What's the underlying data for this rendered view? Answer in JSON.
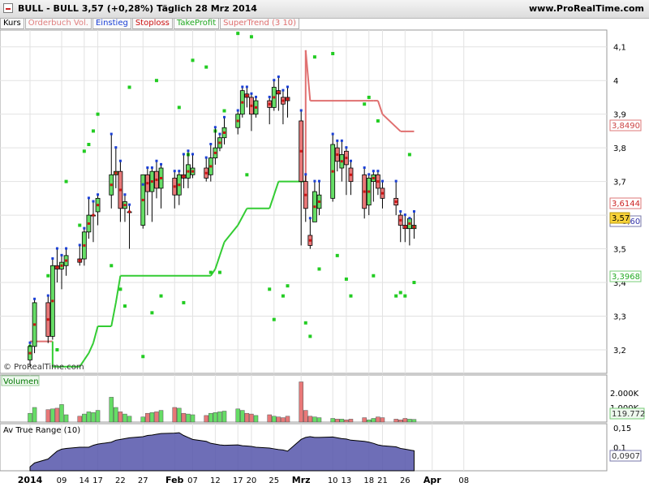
{
  "header": {
    "title": "BULL - BULL    3,57 (+0,28%)    Täglich  28 Mrz 2014",
    "site": "www.ProRealTime.com"
  },
  "tabs": [
    {
      "label": "Kurs",
      "color": "#000000"
    },
    {
      "label": "Orderbuch Vol.",
      "color": "#e08080"
    },
    {
      "label": "Einstieg",
      "color": "#1a3fd6"
    },
    {
      "label": "Stoploss",
      "color": "#cc1111"
    },
    {
      "label": "TakeProfit",
      "color": "#22aa22"
    },
    {
      "label": "SuperTrend (3 10)",
      "color": "#e07070"
    }
  ],
  "watermark": "© ProRealTime.com",
  "panels": {
    "volume_label": "Volumen",
    "atr_label": "Av True Range (10)"
  },
  "badges": {
    "supertrend": "3,8490",
    "stoploss": "3,6144",
    "price": "3,57",
    "price_hidden": "3,60",
    "takeprofit": "3,3968",
    "volume": "119.772",
    "atr": "0,0907"
  },
  "chart_data": {
    "type": "candlestick",
    "title": "BULL - BULL",
    "price_axis": {
      "ylim": [
        3.13,
        4.15
      ],
      "ticks": [
        "4,1",
        "4",
        "3,9",
        "3,8",
        "3,7",
        "3,6",
        "3,5",
        "3,4",
        "3,3",
        "3,2"
      ]
    },
    "volume_axis": {
      "ticks": [
        "2.000K",
        "1.000K"
      ]
    },
    "atr_axis": {
      "ticks": [
        "0,15",
        "0,1"
      ]
    },
    "date_ticks": [
      {
        "label": "2014",
        "date": "2014-01-02"
      },
      {
        "label": "09",
        "date": "2014-01-09"
      },
      {
        "label": "14",
        "date": "2014-01-14"
      },
      {
        "label": "17",
        "date": "2014-01-17"
      },
      {
        "label": "22",
        "date": "2014-01-22"
      },
      {
        "label": "27",
        "date": "2014-01-27"
      },
      {
        "label": "Feb",
        "date": "2014-02-03"
      },
      {
        "label": "07",
        "date": "2014-02-07"
      },
      {
        "label": "12",
        "date": "2014-02-12"
      },
      {
        "label": "17",
        "date": "2014-02-17"
      },
      {
        "label": "20",
        "date": "2014-02-20"
      },
      {
        "label": "25",
        "date": "2014-02-25"
      },
      {
        "label": "Mrz",
        "date": "2014-03-03"
      },
      {
        "label": "10",
        "date": "2014-03-10"
      },
      {
        "label": "13",
        "date": "2014-03-13"
      },
      {
        "label": "18",
        "date": "2014-03-18"
      },
      {
        "label": "21",
        "date": "2014-03-21"
      },
      {
        "label": "26",
        "date": "2014-03-26"
      },
      {
        "label": "Apr",
        "date": "2014-04-01"
      },
      {
        "label": "08",
        "date": "2014-04-08"
      }
    ],
    "candles": [
      {
        "date": "2014-01-02",
        "o": 3.17,
        "h": 3.22,
        "l": 3.15,
        "c": 3.21
      },
      {
        "date": "2014-01-03",
        "o": 3.21,
        "h": 3.35,
        "l": 3.19,
        "c": 3.34
      },
      {
        "date": "2014-01-06",
        "o": 3.34,
        "h": 3.36,
        "l": 3.22,
        "c": 3.24
      },
      {
        "date": "2014-01-07",
        "o": 3.24,
        "h": 3.47,
        "l": 3.23,
        "c": 3.45
      },
      {
        "date": "2014-01-08",
        "o": 3.45,
        "h": 3.5,
        "l": 3.4,
        "c": 3.44
      },
      {
        "date": "2014-01-09",
        "o": 3.44,
        "h": 3.48,
        "l": 3.38,
        "c": 3.46
      },
      {
        "date": "2014-01-10",
        "o": 3.45,
        "h": 3.5,
        "l": 3.42,
        "c": 3.48
      },
      {
        "date": "2014-01-13",
        "o": 3.47,
        "h": 3.51,
        "l": 3.45,
        "c": 3.46
      },
      {
        "date": "2014-01-14",
        "o": 3.47,
        "h": 3.56,
        "l": 3.45,
        "c": 3.55
      },
      {
        "date": "2014-01-15",
        "o": 3.55,
        "h": 3.65,
        "l": 3.53,
        "c": 3.6
      },
      {
        "date": "2014-01-16",
        "o": 3.6,
        "h": 3.64,
        "l": 3.52,
        "c": 3.6
      },
      {
        "date": "2014-01-17",
        "o": 3.61,
        "h": 3.66,
        "l": 3.57,
        "c": 3.65
      },
      {
        "date": "2014-01-20",
        "o": 3.66,
        "h": 3.84,
        "l": 3.62,
        "c": 3.72
      },
      {
        "date": "2014-01-21",
        "o": 3.72,
        "h": 3.8,
        "l": 3.68,
        "c": 3.73
      },
      {
        "date": "2014-01-22",
        "o": 3.73,
        "h": 3.76,
        "l": 3.58,
        "c": 3.62
      },
      {
        "date": "2014-01-23",
        "o": 3.62,
        "h": 3.66,
        "l": 3.58,
        "c": 3.64
      },
      {
        "date": "2014-01-24",
        "o": 3.61,
        "h": 3.63,
        "l": 3.5,
        "c": 3.61
      },
      {
        "date": "2014-01-27",
        "o": 3.57,
        "h": 3.69,
        "l": 3.56,
        "c": 3.72
      },
      {
        "date": "2014-01-28",
        "o": 3.72,
        "h": 3.74,
        "l": 3.6,
        "c": 3.67
      },
      {
        "date": "2014-01-29",
        "o": 3.67,
        "h": 3.74,
        "l": 3.58,
        "c": 3.73
      },
      {
        "date": "2014-01-30",
        "o": 3.73,
        "h": 3.76,
        "l": 3.65,
        "c": 3.68
      },
      {
        "date": "2014-01-31",
        "o": 3.68,
        "h": 3.75,
        "l": 3.62,
        "c": 3.74
      },
      {
        "date": "2014-02-03",
        "o": 3.71,
        "h": 3.73,
        "l": 3.62,
        "c": 3.66
      },
      {
        "date": "2014-02-04",
        "o": 3.66,
        "h": 3.73,
        "l": 3.63,
        "c": 3.72
      },
      {
        "date": "2014-02-05",
        "o": 3.72,
        "h": 3.78,
        "l": 3.68,
        "c": 3.71
      },
      {
        "date": "2014-02-06",
        "o": 3.71,
        "h": 3.79,
        "l": 3.68,
        "c": 3.75
      },
      {
        "date": "2014-02-07",
        "o": 3.72,
        "h": 3.78,
        "l": 3.71,
        "c": 3.74
      },
      {
        "date": "2014-02-10",
        "o": 3.74,
        "h": 3.77,
        "l": 3.7,
        "c": 3.71
      },
      {
        "date": "2014-02-11",
        "o": 3.72,
        "h": 3.81,
        "l": 3.7,
        "c": 3.77
      },
      {
        "date": "2014-02-12",
        "o": 3.77,
        "h": 3.86,
        "l": 3.75,
        "c": 3.8
      },
      {
        "date": "2014-02-13",
        "o": 3.8,
        "h": 3.84,
        "l": 3.79,
        "c": 3.83
      },
      {
        "date": "2014-02-14",
        "o": 3.83,
        "h": 3.89,
        "l": 3.81,
        "c": 3.86
      },
      {
        "date": "2014-02-17",
        "o": 3.86,
        "h": 3.91,
        "l": 3.84,
        "c": 3.9
      },
      {
        "date": "2014-02-18",
        "o": 3.9,
        "h": 3.98,
        "l": 3.89,
        "c": 3.97
      },
      {
        "date": "2014-02-19",
        "o": 3.96,
        "h": 3.98,
        "l": 3.92,
        "c": 3.95
      },
      {
        "date": "2014-02-20",
        "o": 3.95,
        "h": 3.96,
        "l": 3.85,
        "c": 3.9
      },
      {
        "date": "2014-02-21",
        "o": 3.9,
        "h": 3.95,
        "l": 3.89,
        "c": 3.94
      },
      {
        "date": "2014-02-24",
        "o": 3.94,
        "h": 3.95,
        "l": 3.87,
        "c": 3.92
      },
      {
        "date": "2014-02-25",
        "o": 3.92,
        "h": 4.0,
        "l": 3.91,
        "c": 3.98
      },
      {
        "date": "2014-02-26",
        "o": 3.97,
        "h": 4.01,
        "l": 3.91,
        "c": 3.96
      },
      {
        "date": "2014-02-27",
        "o": 3.95,
        "h": 3.97,
        "l": 3.87,
        "c": 3.93
      },
      {
        "date": "2014-02-28",
        "o": 3.95,
        "h": 3.98,
        "l": 3.89,
        "c": 3.94
      },
      {
        "date": "2014-03-03",
        "o": 3.88,
        "h": 3.91,
        "l": 3.51,
        "c": 3.7
      },
      {
        "date": "2014-03-04",
        "o": 3.7,
        "h": 3.72,
        "l": 3.58,
        "c": 3.62
      },
      {
        "date": "2014-03-05",
        "o": 3.54,
        "h": 3.59,
        "l": 3.5,
        "c": 3.51
      },
      {
        "date": "2014-03-06",
        "o": 3.58,
        "h": 3.7,
        "l": 3.58,
        "c": 3.67
      },
      {
        "date": "2014-03-07",
        "o": 3.62,
        "h": 3.7,
        "l": 3.6,
        "c": 3.66
      },
      {
        "date": "2014-03-10",
        "o": 3.65,
        "h": 3.84,
        "l": 3.64,
        "c": 3.81
      },
      {
        "date": "2014-03-11",
        "o": 3.8,
        "h": 3.82,
        "l": 3.73,
        "c": 3.76
      },
      {
        "date": "2014-03-12",
        "o": 3.74,
        "h": 3.82,
        "l": 3.7,
        "c": 3.78
      },
      {
        "date": "2014-03-13",
        "o": 3.79,
        "h": 3.8,
        "l": 3.66,
        "c": 3.75
      },
      {
        "date": "2014-03-14",
        "o": 3.74,
        "h": 3.76,
        "l": 3.66,
        "c": 3.7
      },
      {
        "date": "2014-03-17",
        "o": 3.72,
        "h": 3.74,
        "l": 3.59,
        "c": 3.62
      },
      {
        "date": "2014-03-18",
        "o": 3.63,
        "h": 3.72,
        "l": 3.6,
        "c": 3.71
      },
      {
        "date": "2014-03-19",
        "o": 3.7,
        "h": 3.73,
        "l": 3.64,
        "c": 3.72
      },
      {
        "date": "2014-03-20",
        "o": 3.72,
        "h": 3.73,
        "l": 3.66,
        "c": 3.68
      },
      {
        "date": "2014-03-21",
        "o": 3.68,
        "h": 3.7,
        "l": 3.62,
        "c": 3.65
      },
      {
        "date": "2014-03-24",
        "o": 3.65,
        "h": 3.7,
        "l": 3.6,
        "c": 3.63
      },
      {
        "date": "2014-03-25",
        "o": 3.6,
        "h": 3.61,
        "l": 3.52,
        "c": 3.57
      },
      {
        "date": "2014-03-26",
        "o": 3.57,
        "h": 3.6,
        "l": 3.52,
        "c": 3.56
      },
      {
        "date": "2014-03-27",
        "o": 3.56,
        "h": 3.59,
        "l": 3.51,
        "c": 3.59
      },
      {
        "date": "2014-03-28",
        "o": 3.56,
        "h": 3.61,
        "l": 3.53,
        "c": 3.57
      }
    ],
    "volume": [
      600,
      1000,
      850,
      900,
      950,
      1200,
      500,
      400,
      550,
      700,
      650,
      800,
      1700,
      1000,
      700,
      550,
      400,
      350,
      600,
      650,
      700,
      800,
      1000,
      950,
      600,
      550,
      500,
      450,
      600,
      650,
      700,
      750,
      900,
      800,
      600,
      550,
      450,
      500,
      400,
      350,
      300,
      400,
      2750,
      800,
      400,
      350,
      300,
      250,
      200,
      200,
      150,
      200,
      300,
      150,
      250,
      350,
      300,
      200,
      150,
      250,
      200,
      180
    ],
    "atr": [
      0.05,
      0.06,
      0.07,
      0.08,
      0.09,
      0.095,
      0.097,
      0.1,
      0.1,
      0.1,
      0.105,
      0.108,
      0.113,
      0.118,
      0.12,
      0.122,
      0.124,
      0.127,
      0.13,
      0.131,
      0.133,
      0.135,
      0.136,
      0.137,
      0.13,
      0.125,
      0.12,
      0.115,
      0.11,
      0.108,
      0.106,
      0.105,
      0.106,
      0.104,
      0.103,
      0.102,
      0.1,
      0.098,
      0.096,
      0.094,
      0.093,
      0.09,
      0.12,
      0.125,
      0.127,
      0.125,
      0.125,
      0.126,
      0.124,
      0.122,
      0.121,
      0.118,
      0.115,
      0.113,
      0.11,
      0.106,
      0.104,
      0.101,
      0.097,
      0.095,
      0.093,
      0.091
    ],
    "supertrend": [
      {
        "date": "2014-01-02",
        "v": 3.225,
        "side": "down"
      },
      {
        "date": "2014-01-06",
        "v": 3.225,
        "side": "down"
      },
      {
        "date": "2014-01-07",
        "v": 3.15,
        "side": "up"
      },
      {
        "date": "2014-01-13",
        "v": 3.15,
        "side": "up"
      },
      {
        "date": "2014-01-15",
        "v": 3.19,
        "side": "up"
      },
      {
        "date": "2014-01-16",
        "v": 3.22,
        "side": "up"
      },
      {
        "date": "2014-01-17",
        "v": 3.27,
        "side": "up"
      },
      {
        "date": "2014-01-20",
        "v": 3.27,
        "side": "up"
      },
      {
        "date": "2014-01-21",
        "v": 3.34,
        "side": "up"
      },
      {
        "date": "2014-01-22",
        "v": 3.42,
        "side": "up"
      },
      {
        "date": "2014-02-11",
        "v": 3.42,
        "side": "up"
      },
      {
        "date": "2014-02-12",
        "v": 3.44,
        "side": "up"
      },
      {
        "date": "2014-02-13",
        "v": 3.48,
        "side": "up"
      },
      {
        "date": "2014-02-14",
        "v": 3.52,
        "side": "up"
      },
      {
        "date": "2014-02-17",
        "v": 3.57,
        "side": "up"
      },
      {
        "date": "2014-02-19",
        "v": 3.62,
        "side": "up"
      },
      {
        "date": "2014-02-24",
        "v": 3.62,
        "side": "up"
      },
      {
        "date": "2014-02-26",
        "v": 3.7,
        "side": "up"
      },
      {
        "date": "2014-03-03",
        "v": 3.7,
        "side": "up"
      },
      {
        "date": "2014-03-04",
        "v": 4.09,
        "side": "down"
      },
      {
        "date": "2014-03-05",
        "v": 3.94,
        "side": "down"
      },
      {
        "date": "2014-03-19",
        "v": 3.94,
        "side": "down"
      },
      {
        "date": "2014-03-20",
        "v": 3.94,
        "side": "down"
      },
      {
        "date": "2014-03-21",
        "v": 3.9,
        "side": "down"
      },
      {
        "date": "2014-03-25",
        "v": 3.849,
        "side": "down"
      },
      {
        "date": "2014-03-28",
        "v": 3.849,
        "side": "down"
      }
    ],
    "takeprofit_dots": [
      {
        "date": "2014-01-02",
        "v": 3.21
      },
      {
        "date": "2014-01-06",
        "v": 3.42
      },
      {
        "date": "2014-01-08",
        "v": 3.2
      },
      {
        "date": "2014-01-10",
        "v": 3.7
      },
      {
        "date": "2014-01-13",
        "v": 3.57
      },
      {
        "date": "2014-01-14",
        "v": 3.79
      },
      {
        "date": "2014-01-15",
        "v": 3.81
      },
      {
        "date": "2014-01-16",
        "v": 3.85
      },
      {
        "date": "2014-01-17",
        "v": 3.9
      },
      {
        "date": "2014-01-20",
        "v": 3.45
      },
      {
        "date": "2014-01-22",
        "v": 3.38
      },
      {
        "date": "2014-01-23",
        "v": 3.33
      },
      {
        "date": "2014-01-24",
        "v": 3.98
      },
      {
        "date": "2014-01-27",
        "v": 3.18
      },
      {
        "date": "2014-01-28",
        "v": 3.68
      },
      {
        "date": "2014-01-29",
        "v": 3.31
      },
      {
        "date": "2014-01-30",
        "v": 4.0
      },
      {
        "date": "2014-01-31",
        "v": 3.36
      },
      {
        "date": "2014-02-04",
        "v": 3.92
      },
      {
        "date": "2014-02-05",
        "v": 3.34
      },
      {
        "date": "2014-02-06",
        "v": 3.78
      },
      {
        "date": "2014-02-07",
        "v": 4.06
      },
      {
        "date": "2014-02-10",
        "v": 4.04
      },
      {
        "date": "2014-02-11",
        "v": 3.43
      },
      {
        "date": "2014-02-12",
        "v": 3.85
      },
      {
        "date": "2014-02-13",
        "v": 3.43
      },
      {
        "date": "2014-02-14",
        "v": 3.91
      },
      {
        "date": "2014-02-17",
        "v": 4.14
      },
      {
        "date": "2014-02-18",
        "v": 3.92
      },
      {
        "date": "2014-02-19",
        "v": 3.72
      },
      {
        "date": "2014-02-20",
        "v": 4.13
      },
      {
        "date": "2014-02-24",
        "v": 3.38
      },
      {
        "date": "2014-02-25",
        "v": 3.29
      },
      {
        "date": "2014-02-27",
        "v": 3.36
      },
      {
        "date": "2014-02-28",
        "v": 3.39
      },
      {
        "date": "2014-03-04",
        "v": 3.28
      },
      {
        "date": "2014-03-05",
        "v": 3.24
      },
      {
        "date": "2014-03-06",
        "v": 4.07
      },
      {
        "date": "2014-03-07",
        "v": 3.44
      },
      {
        "date": "2014-03-10",
        "v": 4.08
      },
      {
        "date": "2014-03-11",
        "v": 3.48
      },
      {
        "date": "2014-03-13",
        "v": 3.41
      },
      {
        "date": "2014-03-14",
        "v": 3.36
      },
      {
        "date": "2014-03-17",
        "v": 3.93
      },
      {
        "date": "2014-03-18",
        "v": 3.95
      },
      {
        "date": "2014-03-19",
        "v": 3.42
      },
      {
        "date": "2014-03-20",
        "v": 3.88
      },
      {
        "date": "2014-03-24",
        "v": 3.36
      },
      {
        "date": "2014-03-25",
        "v": 3.37
      },
      {
        "date": "2014-03-26",
        "v": 3.36
      },
      {
        "date": "2014-03-27",
        "v": 3.78
      },
      {
        "date": "2014-03-28",
        "v": 3.4
      }
    ]
  }
}
